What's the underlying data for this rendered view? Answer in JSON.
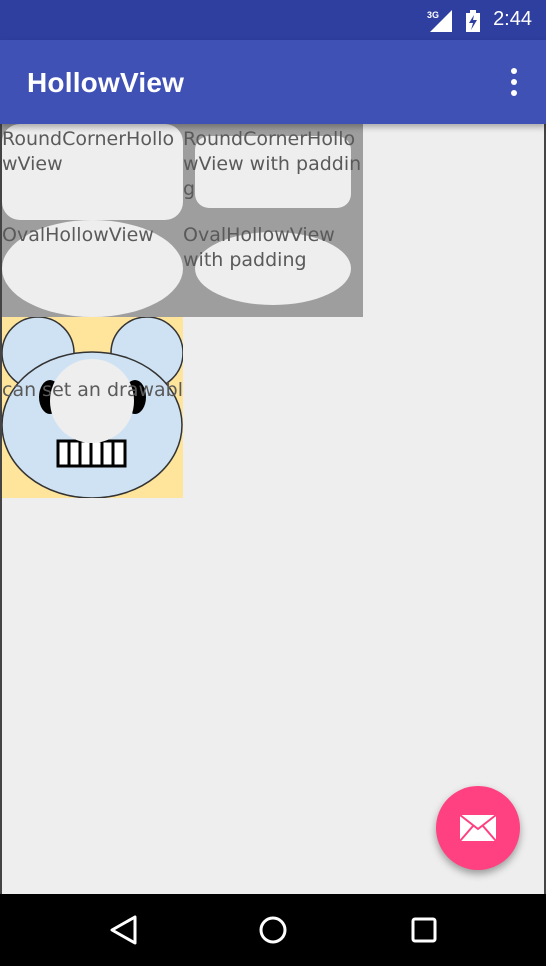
{
  "status_bar": {
    "network": "3G",
    "time": "2:44",
    "icons": [
      "signal-icon",
      "battery-charging-icon"
    ]
  },
  "app_bar": {
    "title": "HollowView",
    "menu_icon": "more-vert-icon"
  },
  "grid": {
    "cells": [
      {
        "label": "RoundCornerHollowView"
      },
      {
        "label": "RoundCornerHollowView with padding"
      },
      {
        "label": "OvalHollowView"
      },
      {
        "label": "OvalHollowView with padding"
      }
    ]
  },
  "drawable_demo": {
    "label": "can set an drawable"
  },
  "fab": {
    "icon": "mail-icon",
    "color": "#ff4081"
  },
  "nav_bar": {
    "icons": [
      "back-icon",
      "home-icon",
      "recents-icon"
    ]
  },
  "colors": {
    "primary": "#3f51b5",
    "primary_dark": "#2f3fa0",
    "accent": "#ff4081"
  }
}
